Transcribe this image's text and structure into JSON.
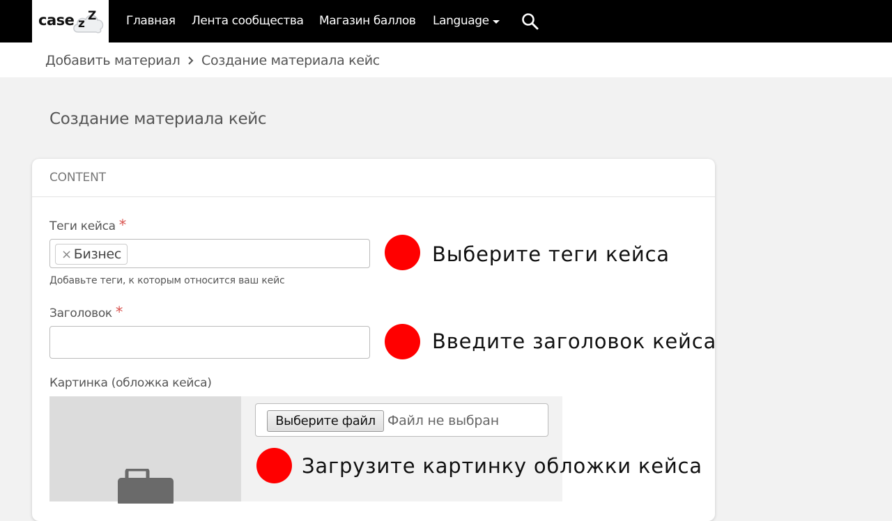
{
  "header": {
    "logo": {
      "main": "case",
      "z_small": "z",
      "z_large": "Z"
    },
    "nav": [
      {
        "label": "Главная"
      },
      {
        "label": "Лента сообщества"
      },
      {
        "label": "Магазин баллов"
      },
      {
        "label": "Language"
      }
    ],
    "search_icon": "search-icon"
  },
  "breadcrumb": {
    "items": [
      {
        "label": "Добавить материал"
      },
      {
        "label": "Создание материала кейс"
      }
    ],
    "separator_icon": "chevron-right-icon"
  },
  "page_title": "Создание материала кейс",
  "card": {
    "header": "CONTENT",
    "tags_field": {
      "label": "Теги кейса",
      "required_mark": "*",
      "tags": [
        {
          "remove": "×",
          "label": "Бизнес"
        }
      ],
      "help": "Добавьте теги, к которым относится ваш кейс",
      "hint": "Выберите теги кейса"
    },
    "title_field": {
      "label": "Заголовок",
      "required_mark": "*",
      "value": "",
      "hint": "Введите заголовок кейса"
    },
    "image_field": {
      "label": "Картинка (обложка кейса)",
      "file_button": "Выберите файл",
      "file_status": "Файл не выбран",
      "placeholder_icon": "briefcase-icon",
      "hint": "Загрузите картинку обложки кейса"
    }
  },
  "colors": {
    "topbar": "#000000",
    "hint_dot": "#ff0000",
    "required": "#d9534f",
    "page_bg": "#f2f2f2"
  }
}
